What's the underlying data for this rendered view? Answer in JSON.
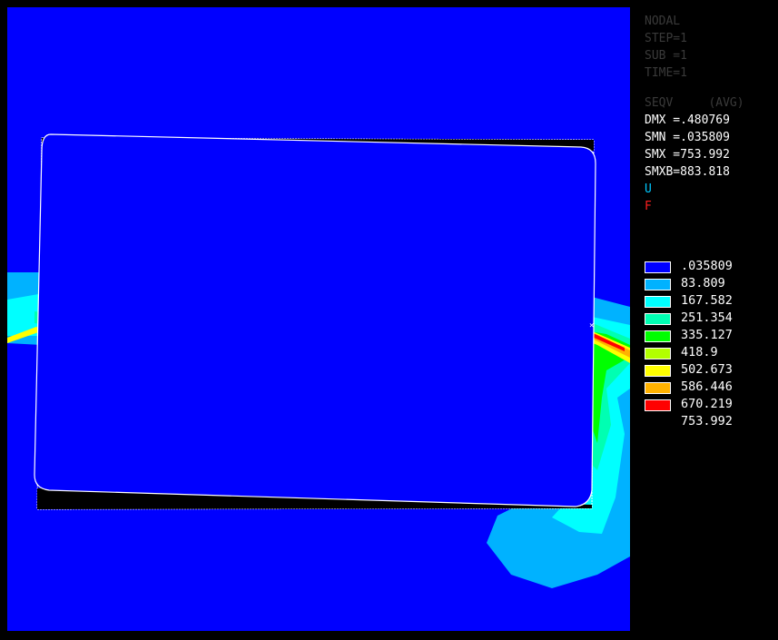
{
  "plot": {
    "background_color": "#0000ff",
    "contour_colors": [
      "#0000ff",
      "#00b2ff",
      "#00ffff",
      "#00ffb2",
      "#00ff00",
      "#b2ff00",
      "#ffff00",
      "#ffb200",
      "#ff0000"
    ]
  },
  "info_panel": {
    "faded_lines": [
      "NODAL",
      "STEP=1",
      "SUB =1",
      "TIME=1",
      "SEQV     (AVG)"
    ],
    "DMX": "DMX =.480769",
    "SMN": "SMN =.035809",
    "SMX": "SMX =753.992",
    "SMXB": "SMXB=883.818",
    "U_label": "U",
    "F_label": "F",
    "U_color": "#00c8ff",
    "F_color": "#ff2020"
  },
  "legend": {
    "values": [
      ".035809",
      "83.809",
      "167.582",
      "251.354",
      "335.127",
      "418.9",
      "502.673",
      "586.446",
      "670.219",
      "753.992"
    ],
    "colors": [
      "#0000ff",
      "#00b2ff",
      "#00ffff",
      "#00ffb2",
      "#00ff00",
      "#b2ff00",
      "#ffff00",
      "#ffb200",
      "#ff0000"
    ]
  }
}
